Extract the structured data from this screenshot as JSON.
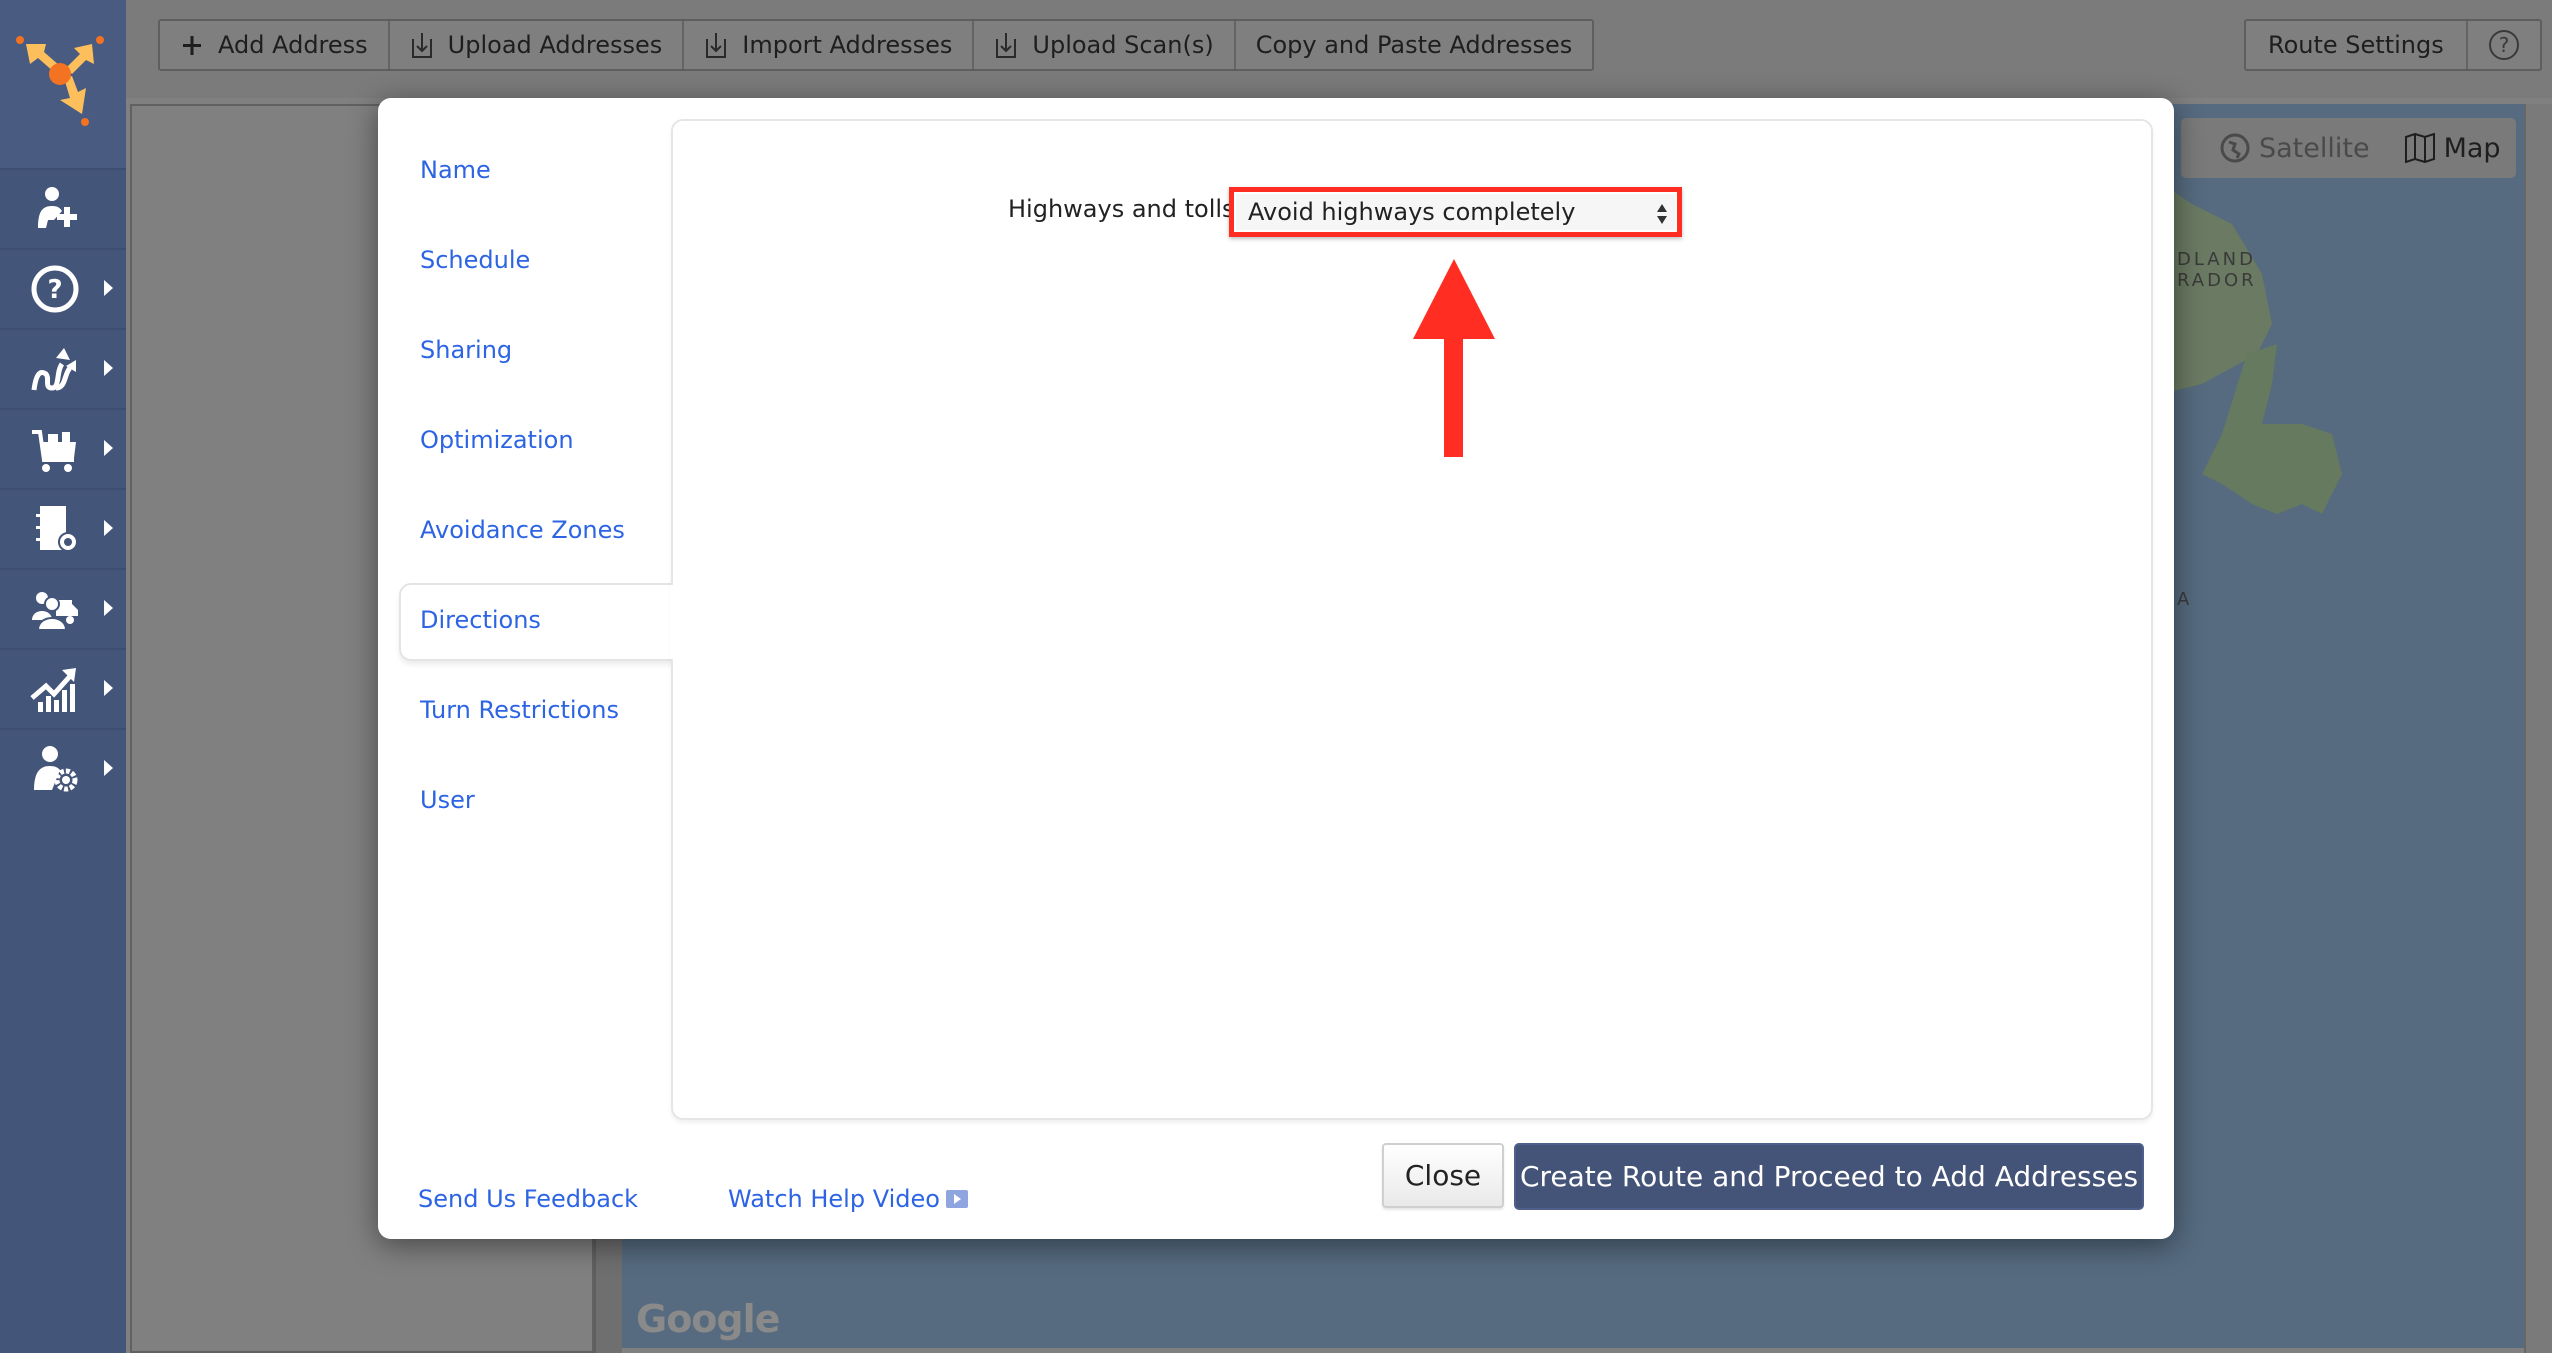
{
  "sidebar": {
    "items": [
      {
        "icon": "add-user-icon",
        "has_submenu": false
      },
      {
        "icon": "help-icon",
        "has_submenu": true
      },
      {
        "icon": "routes-icon",
        "has_submenu": true
      },
      {
        "icon": "cart-icon",
        "has_submenu": true
      },
      {
        "icon": "address-book-icon",
        "has_submenu": true
      },
      {
        "icon": "team-vehicle-icon",
        "has_submenu": true
      },
      {
        "icon": "analytics-icon",
        "has_submenu": true
      },
      {
        "icon": "user-settings-icon",
        "has_submenu": true
      }
    ]
  },
  "toolbar": {
    "buttons": [
      {
        "label": "Add Address",
        "icon": "plus-icon"
      },
      {
        "label": "Upload Addresses",
        "icon": "upload-icon"
      },
      {
        "label": "Import Addresses",
        "icon": "import-icon"
      },
      {
        "label": "Upload Scan(s)",
        "icon": "upload-scan-icon"
      },
      {
        "label": "Copy and Paste Addresses"
      }
    ],
    "route_settings_label": "Route Settings",
    "help_label": "?"
  },
  "map": {
    "satellite_label": "Satellite",
    "map_label": "Map",
    "region_label_1": "DLAND",
    "region_label_2": "RADOR",
    "region_label_3": "A",
    "provider": "Google"
  },
  "modal": {
    "nav": [
      {
        "label": "Name"
      },
      {
        "label": "Schedule"
      },
      {
        "label": "Sharing"
      },
      {
        "label": "Optimization"
      },
      {
        "label": "Avoidance Zones"
      },
      {
        "label": "Directions",
        "active": true
      },
      {
        "label": "Turn Restrictions"
      },
      {
        "label": "User"
      }
    ],
    "directions": {
      "highways_label": "Highways and tolls:",
      "highways_value": "Avoid highways completely"
    },
    "footer": {
      "feedback_label": "Send Us Feedback",
      "help_video_label": "Watch Help Video",
      "close_label": "Close",
      "create_label": "Create Route and Proceed to Add Addresses"
    }
  },
  "colors": {
    "sidebar": "#44557a",
    "link": "#2c64e3",
    "primary_button": "#445478",
    "highlight": "#ff2d22"
  }
}
